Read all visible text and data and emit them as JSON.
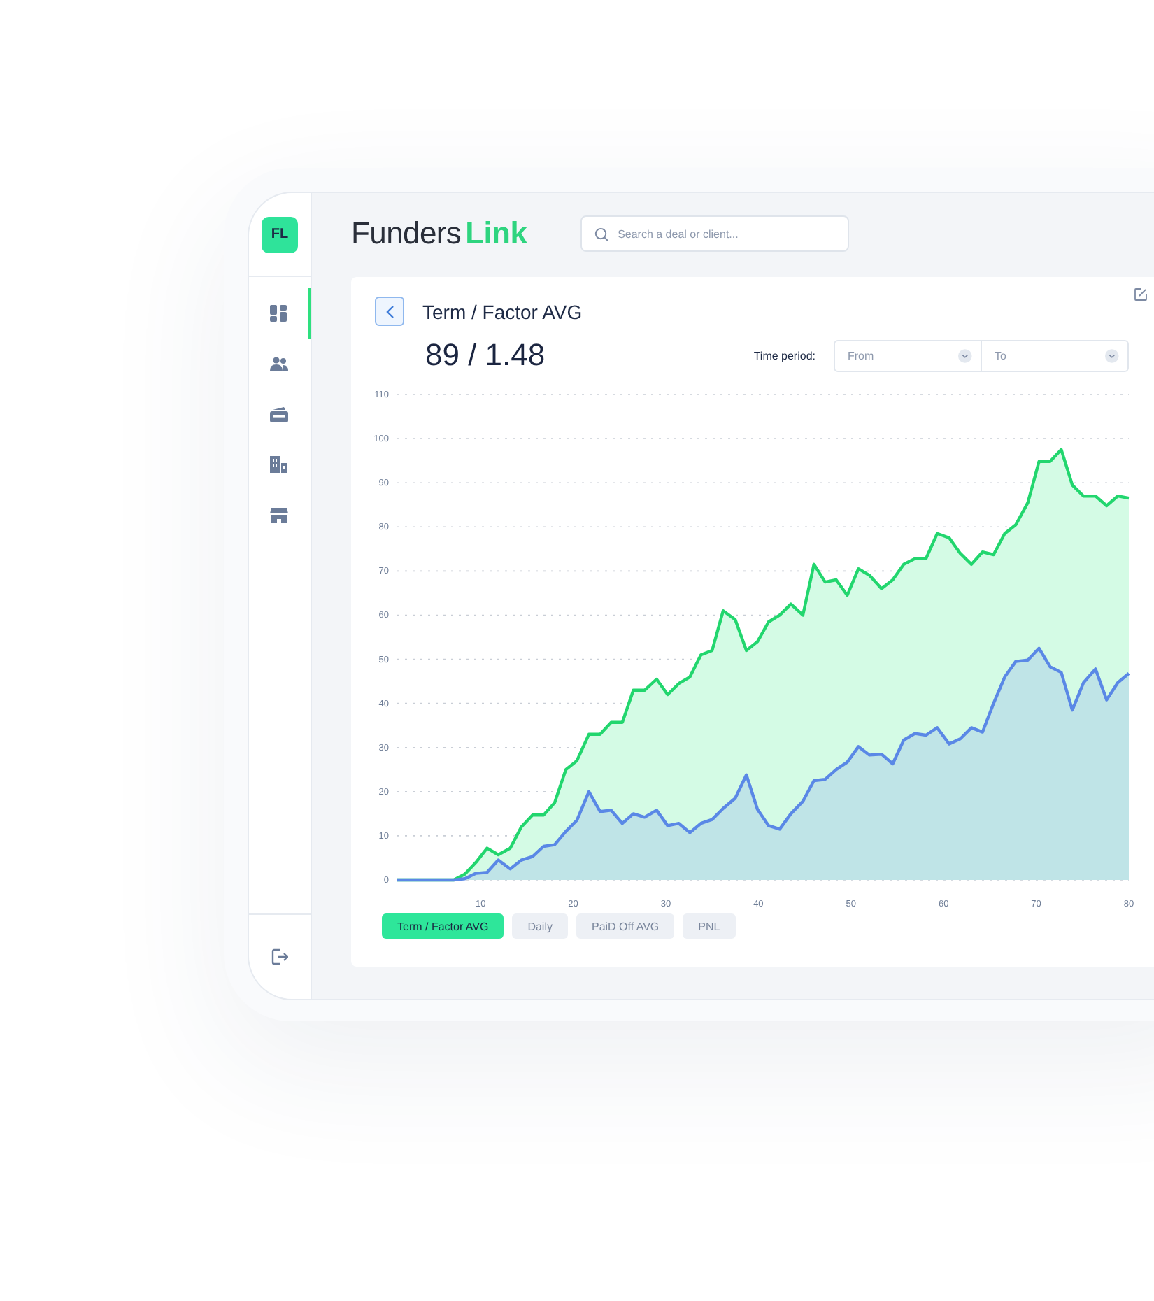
{
  "sidebar": {
    "logo": "FL",
    "items": [
      {
        "kind": "grid",
        "selected": true
      },
      {
        "kind": "people",
        "selected": false
      },
      {
        "kind": "cards",
        "selected": false
      },
      {
        "kind": "buildings",
        "selected": false
      },
      {
        "kind": "store",
        "selected": false
      }
    ]
  },
  "header": {
    "brand": [
      "Funders",
      "Link"
    ],
    "search": {
      "placeholder": "Search a deal or client..."
    }
  },
  "card": {
    "title": "Term / Factor AVG",
    "value": "89 / 1.48",
    "time_period": {
      "label": "Time period:",
      "from": {
        "placeholder": "From"
      },
      "to": {
        "placeholder": "To"
      }
    },
    "chart_data": {
      "type": "area",
      "x": [
        1,
        2.2,
        3.4,
        4.6,
        5.9,
        7.1,
        8.3,
        9.5,
        10.7,
        11.9,
        13.2,
        14.4,
        15.6,
        16.8,
        18.0,
        19.2,
        20.4,
        21.7,
        22.9,
        24.1,
        25.3,
        26.5,
        27.7,
        29.0,
        30.2,
        31.4,
        32.6,
        33.8,
        35.0,
        36.2,
        37.5,
        38.7,
        39.9,
        41.1,
        42.3,
        43.5,
        44.8,
        46.0,
        47.2,
        48.4,
        49.6,
        50.8,
        52.0,
        53.3,
        54.5,
        55.7,
        56.9,
        58.1,
        59.3,
        60.6,
        61.8,
        63.0,
        64.2,
        65.4,
        66.6,
        67.8,
        69.1,
        70.3,
        71.5,
        72.7,
        73.9,
        75.1,
        76.4,
        77.6,
        78.8,
        80
      ],
      "series": [
        {
          "color": "#22d66e",
          "values": [
            0,
            0,
            0,
            0,
            0,
            0,
            1.3,
            4,
            7.2,
            5.7,
            7.2,
            12,
            14.7,
            14.7,
            17.5,
            25,
            27,
            33,
            33,
            35.7,
            35.7,
            43,
            43,
            45.5,
            42,
            44.5,
            46,
            51,
            52,
            61,
            59,
            52,
            54,
            58.5,
            60,
            62.5,
            60,
            71.5,
            67.5,
            68,
            64.5,
            70.5,
            69,
            66,
            68,
            71.5,
            72.8,
            72.8,
            78.5,
            77.5,
            74,
            71.5,
            74.3,
            73.7,
            78.5,
            80.5,
            85.5,
            94.8,
            94.8,
            97.5,
            89.5,
            87,
            87,
            84.8,
            87,
            86.5
          ]
        },
        {
          "color": "#5a88e6",
          "values": [
            0,
            0,
            0,
            0,
            0,
            0,
            0.3,
            1.5,
            1.7,
            4.5,
            2.5,
            4.5,
            5.3,
            7.6,
            8,
            11,
            13.5,
            20,
            15.5,
            15.8,
            12.8,
            15,
            14.2,
            15.8,
            12.3,
            12.8,
            10.7,
            12.8,
            13.7,
            16.2,
            18.5,
            23.8,
            16,
            12.3,
            11.5,
            15,
            17.8,
            22.5,
            22.8,
            25,
            26.7,
            30.2,
            28.3,
            28.5,
            26.3,
            31.7,
            33.2,
            32.8,
            34.5,
            30.8,
            32,
            34.5,
            33.5,
            40,
            46,
            49.5,
            49.8,
            52.5,
            48.3,
            47,
            38.5,
            44.7,
            47.8,
            40.8,
            44.7,
            46.8
          ]
        }
      ],
      "grid": true,
      "xlim": [
        1,
        80
      ],
      "ylim": [
        0,
        110
      ],
      "xticks": [
        10,
        20,
        30,
        40,
        50,
        60,
        70,
        80
      ],
      "yticks": [
        0,
        10,
        20,
        30,
        40,
        50,
        60,
        70,
        80,
        90,
        100,
        110
      ]
    },
    "tabs": [
      {
        "label": "Term / Factor AVG",
        "selected": true
      },
      {
        "label": "Daily",
        "selected": false
      },
      {
        "label": "PaiD Off AVG",
        "selected": false
      },
      {
        "label": "PNL",
        "selected": false
      }
    ]
  }
}
